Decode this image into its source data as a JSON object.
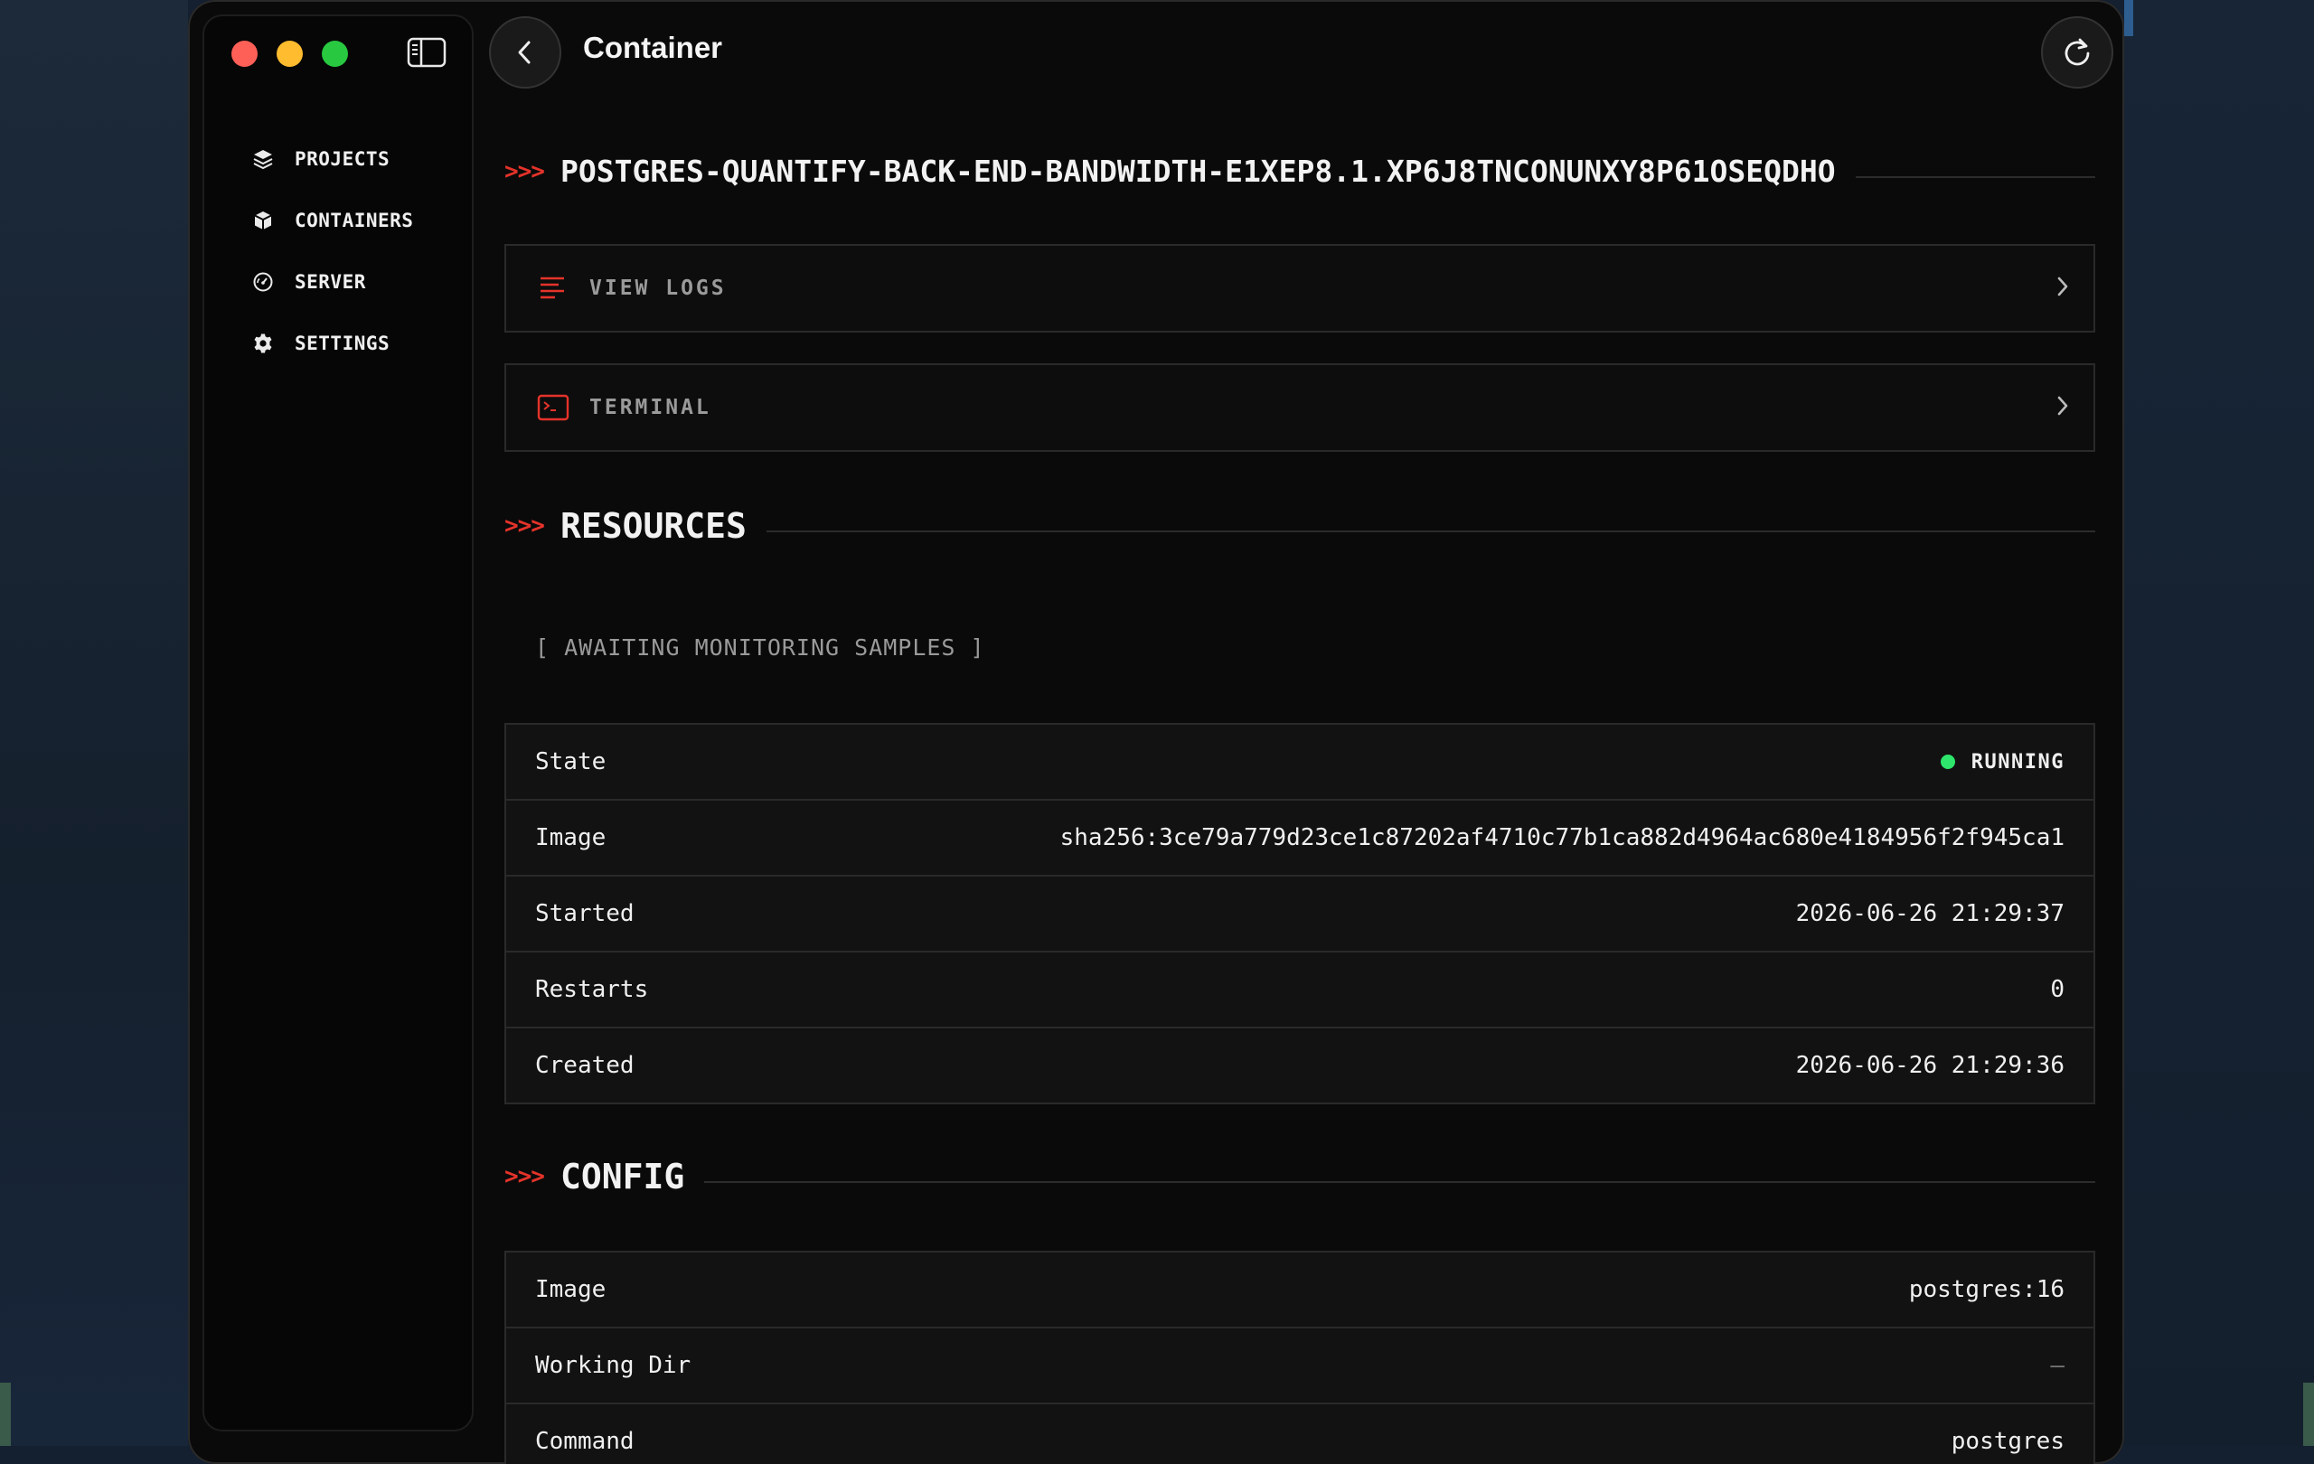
{
  "window": {
    "title": "Container"
  },
  "sidebar": {
    "items": [
      {
        "label": "PROJECTS",
        "icon": "layers-icon"
      },
      {
        "label": "CONTAINERS",
        "icon": "box-icon"
      },
      {
        "label": "SERVER",
        "icon": "gauge-icon"
      },
      {
        "label": "SETTINGS",
        "icon": "gear-icon"
      }
    ]
  },
  "container": {
    "name": "POSTGRES-QUANTIFY-BACK-END-BANDWIDTH-E1XEP8.1.XP6J8TNCONUNXY8P61OSEQDHO"
  },
  "actions": {
    "view_logs": "VIEW LOGS",
    "terminal": "TERMINAL"
  },
  "prompt": ">>>",
  "resources": {
    "title": "RESOURCES",
    "awaiting": "[ AWAITING MONITORING SAMPLES ]"
  },
  "details": {
    "state": {
      "label": "State",
      "value": "RUNNING"
    },
    "image": {
      "label": "Image",
      "value": "sha256:3ce79a779d23ce1c87202af4710c77b1ca882d4964ac680e4184956f2f945ca1"
    },
    "started": {
      "label": "Started",
      "value": "2026-06-26 21:29:37"
    },
    "restarts": {
      "label": "Restarts",
      "value": "0"
    },
    "created": {
      "label": "Created",
      "value": "2026-06-26 21:29:36"
    }
  },
  "config": {
    "title": "CONFIG",
    "image": {
      "label": "Image",
      "value": "postgres:16"
    },
    "working_dir": {
      "label": "Working Dir",
      "value": "—"
    },
    "command": {
      "label": "Command",
      "value": "postgres"
    }
  },
  "colors": {
    "accent": "#e5332a",
    "running": "#2ee66b",
    "background": "#0a0a0a"
  }
}
